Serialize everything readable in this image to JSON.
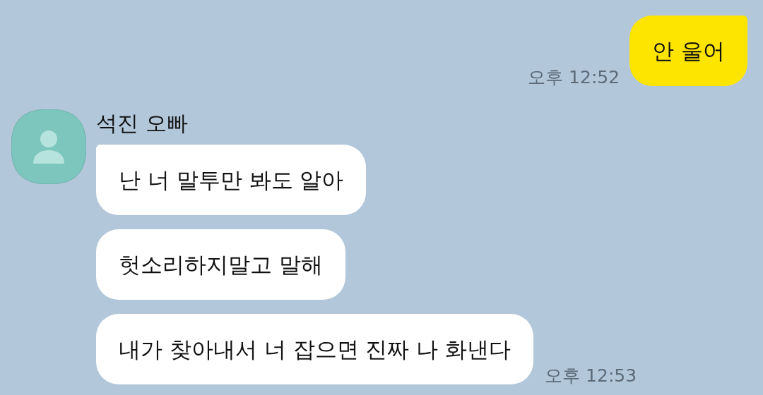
{
  "messages": [
    {
      "kind": "sent",
      "bubbles": [
        "안 울어"
      ],
      "time": "오후 12:52"
    },
    {
      "kind": "received",
      "sender": "석진 오빠",
      "bubbles": [
        "난 너 말투만 봐도 알아",
        "헛소리하지말고 말해",
        "내가 찾아내서 너 잡으면 진짜 나 화낸다"
      ],
      "time": "오후 12:53"
    }
  ]
}
